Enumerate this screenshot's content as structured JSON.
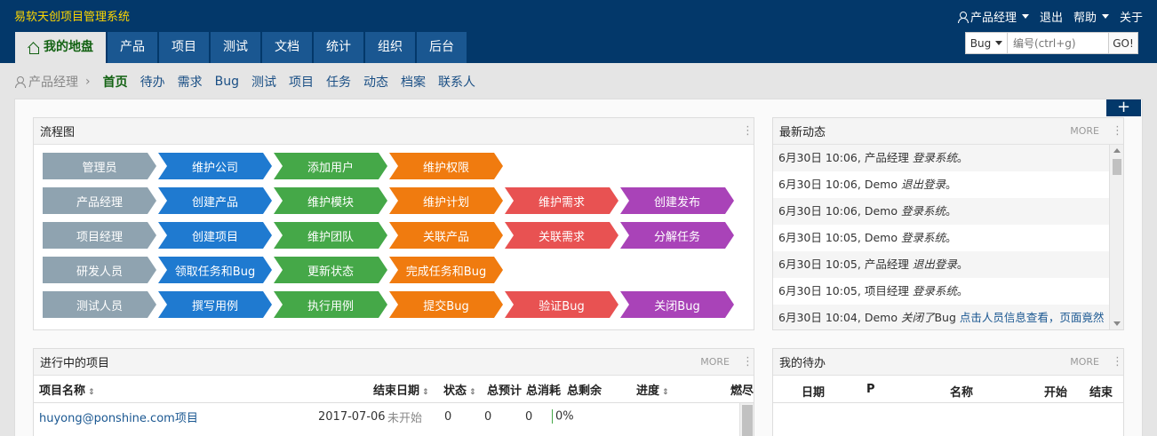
{
  "header": {
    "brand": "易软天创项目管理系统",
    "user": "产品经理",
    "logout": "退出",
    "help": "帮助",
    "about": "关于"
  },
  "mainnav": [
    "我的地盘",
    "产品",
    "项目",
    "测试",
    "文档",
    "统计",
    "组织",
    "后台"
  ],
  "search": {
    "type": "Bug",
    "placeholder": "编号(ctrl+g)",
    "go": "GO!"
  },
  "subnav": {
    "crumb": "产品经理",
    "links": [
      "首页",
      "待办",
      "需求",
      "Bug",
      "测试",
      "项目",
      "任务",
      "动态",
      "档案",
      "联系人"
    ]
  },
  "plus": "+",
  "flow": {
    "title": "流程图",
    "rows": [
      [
        "管理员",
        "维护公司",
        "添加用户",
        "维护权限"
      ],
      [
        "产品经理",
        "创建产品",
        "维护模块",
        "维护计划",
        "维护需求",
        "创建发布"
      ],
      [
        "项目经理",
        "创建项目",
        "维护团队",
        "关联产品",
        "关联需求",
        "分解任务"
      ],
      [
        "研发人员",
        "领取任务和Bug",
        "更新状态",
        "完成任务和Bug"
      ],
      [
        "测试人员",
        "撰写用例",
        "执行用例",
        "提交Bug",
        "验证Bug",
        "关闭Bug"
      ]
    ]
  },
  "dynamics": {
    "title": "最新动态",
    "more": "MORE",
    "items": [
      {
        "time": "6月30日 10:06,",
        "user": "产品经理",
        "action": "登录系统",
        "object": "",
        "end": "。"
      },
      {
        "time": "6月30日 10:06,",
        "user": "Demo",
        "action": "退出登录",
        "object": "",
        "end": "。"
      },
      {
        "time": "6月30日 10:06,",
        "user": "Demo",
        "action": "登录系统",
        "object": "",
        "end": "。"
      },
      {
        "time": "6月30日 10:05,",
        "user": "Demo",
        "action": "登录系统",
        "object": "",
        "end": "。"
      },
      {
        "time": "6月30日 10:05,",
        "user": "产品经理",
        "action": "退出登录",
        "object": "",
        "end": "。"
      },
      {
        "time": "6月30日 10:05,",
        "user": "项目经理",
        "action": "登录系统",
        "object": "",
        "end": "。"
      },
      {
        "time": "6月30日 10:04,",
        "user": "Demo",
        "action": "关闭了",
        "object_type": "Bug",
        "object": "点击人员信息查看，页面竟然",
        "end": ""
      }
    ]
  },
  "projects": {
    "title": "进行中的项目",
    "more": "MORE",
    "columns": [
      "项目名称",
      "结束日期",
      "状态",
      "总预计",
      "总消耗",
      "总剩余",
      "进度",
      "燃尽"
    ],
    "rows": [
      {
        "name": "huyong@ponshine.com项目",
        "end": "2017-07-06",
        "status": "未开始",
        "estimate": "0",
        "consumed": "0",
        "left": "0",
        "progress": "0%"
      }
    ]
  },
  "todo": {
    "title": "我的待办",
    "more": "MORE",
    "columns": [
      "日期",
      "P",
      "名称",
      "开始",
      "结束"
    ]
  }
}
